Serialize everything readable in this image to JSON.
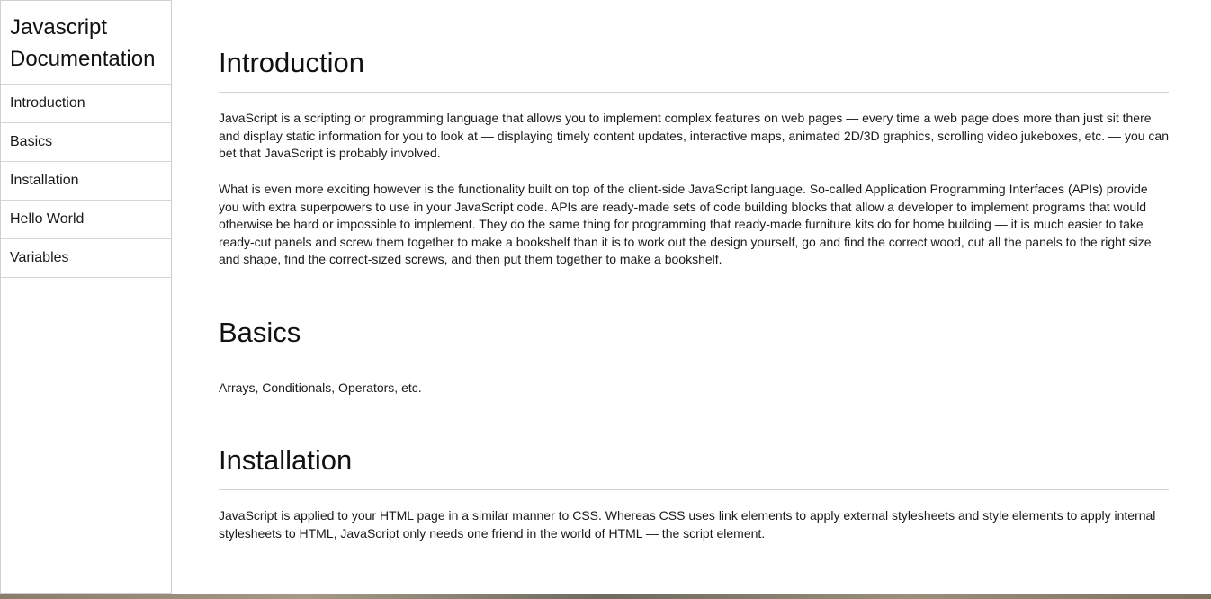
{
  "sidebar": {
    "title": "Javascript Documentation",
    "items": [
      {
        "label": "Introduction"
      },
      {
        "label": "Basics"
      },
      {
        "label": "Installation"
      },
      {
        "label": "Hello World"
      },
      {
        "label": "Variables"
      }
    ]
  },
  "main": {
    "sections": [
      {
        "heading": "Introduction",
        "paragraphs": [
          "JavaScript is a scripting or programming language that allows you to implement complex features on web pages — every time a web page does more than just sit there and display static information for you to look at — displaying timely content updates, interactive maps, animated 2D/3D graphics, scrolling video jukeboxes, etc. — you can bet that JavaScript is probably involved.",
          "What is even more exciting however is the functionality built on top of the client-side JavaScript language. So-called Application Programming Interfaces (APIs) provide you with extra superpowers to use in your JavaScript code. APIs are ready-made sets of code building blocks that allow a developer to implement programs that would otherwise be hard or impossible to implement. They do the same thing for programming that ready-made furniture kits do for home building — it is much easier to take ready-cut panels and screw them together to make a bookshelf than it is to work out the design yourself, go and find the correct wood, cut all the panels to the right size and shape, find the correct-sized screws, and then put them together to make a bookshelf."
        ]
      },
      {
        "heading": "Basics",
        "paragraphs": [
          "Arrays, Conditionals, Operators, etc."
        ]
      },
      {
        "heading": "Installation",
        "paragraphs": [
          "JavaScript is applied to your HTML page in a similar manner to CSS. Whereas CSS uses link elements to apply external stylesheets and style elements to apply internal stylesheets to HTML, JavaScript only needs one friend in the world of HTML — the script element."
        ]
      }
    ]
  }
}
